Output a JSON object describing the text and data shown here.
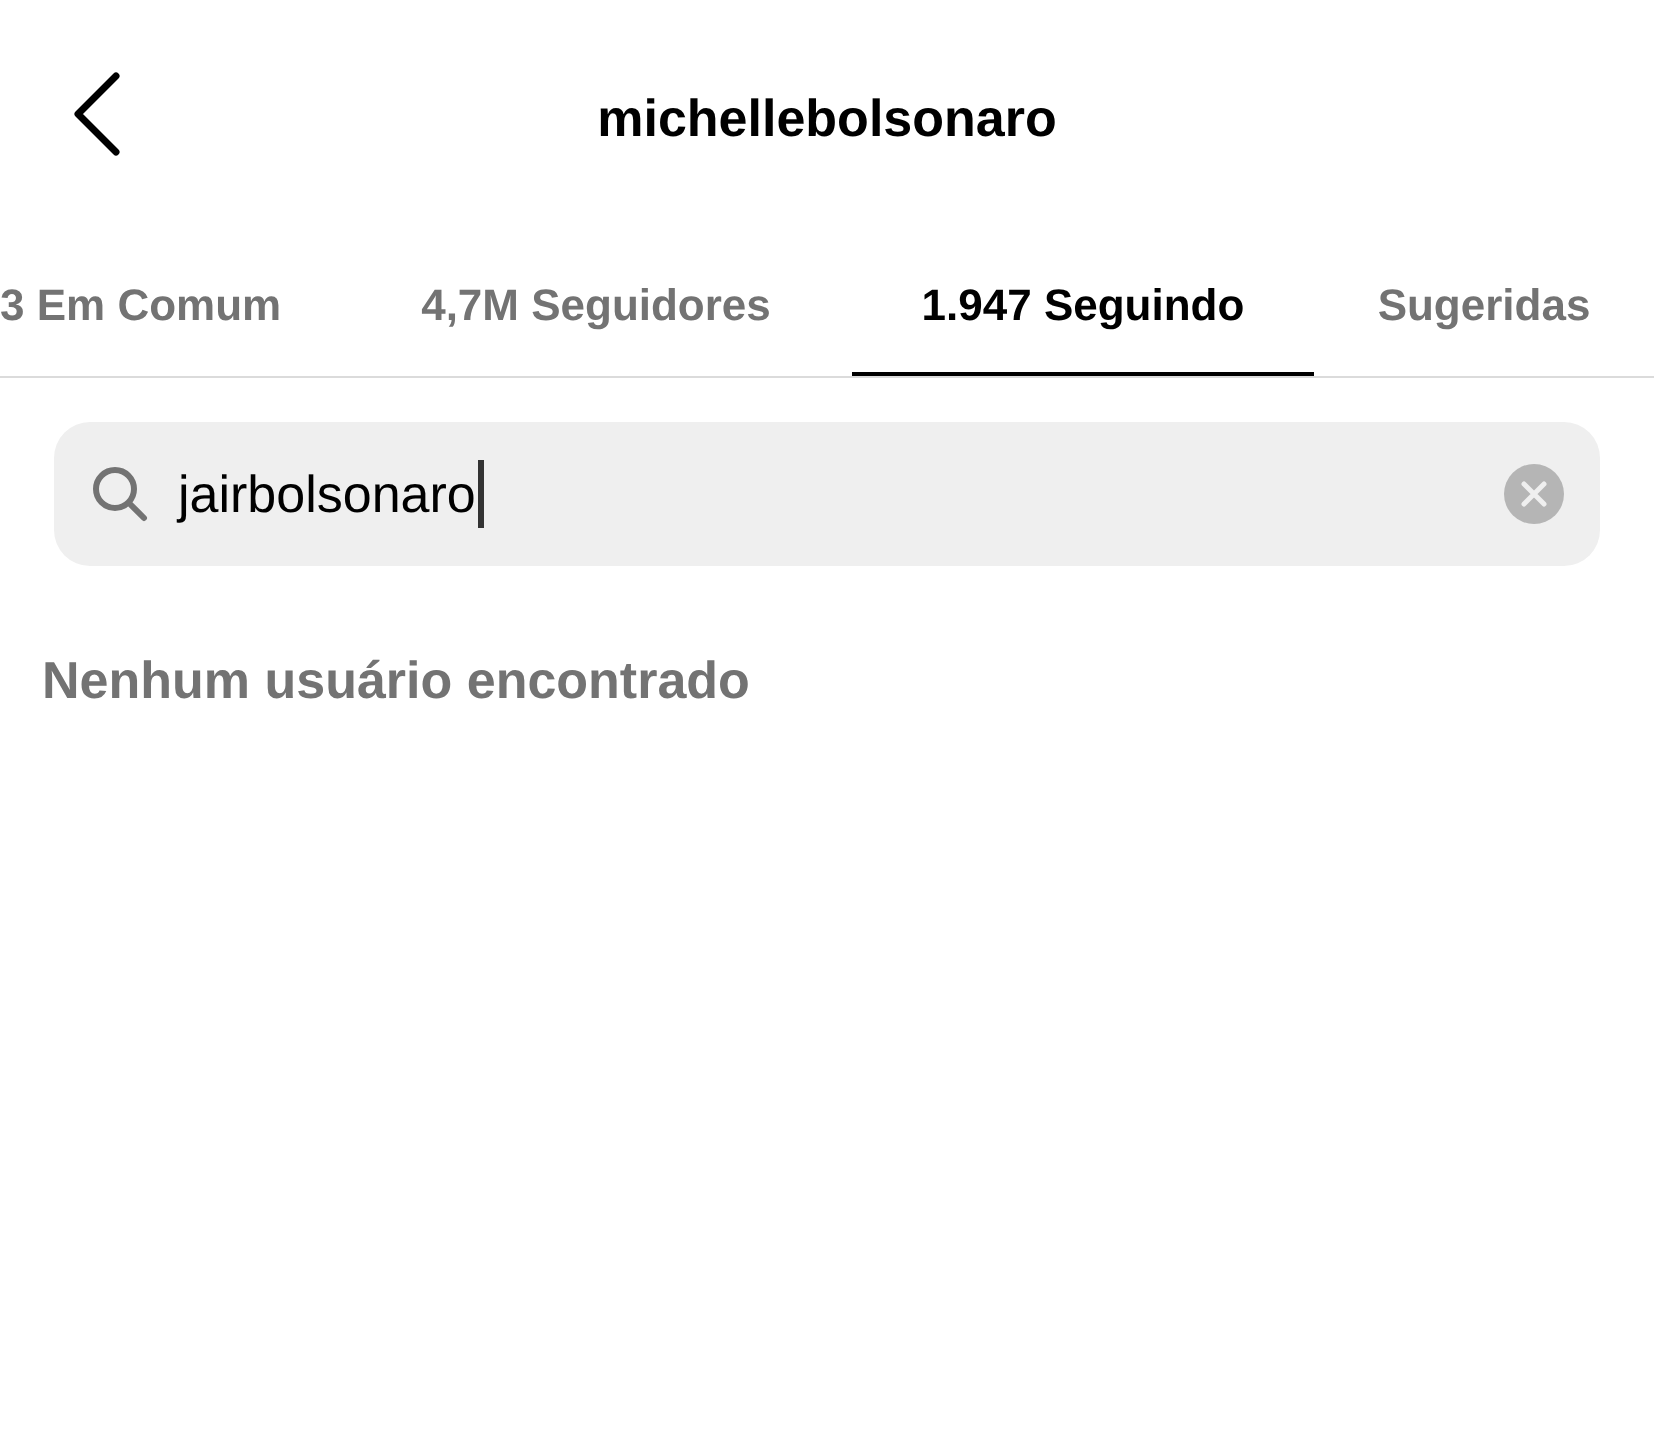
{
  "header": {
    "title": "michellebolsonaro"
  },
  "tabs": [
    {
      "label": "3 Em Comum",
      "selected": false
    },
    {
      "label": "4,7M Seguidores",
      "selected": false
    },
    {
      "label": "1.947 Seguindo",
      "selected": true
    },
    {
      "label": "Sugeridas",
      "selected": false
    }
  ],
  "search": {
    "value": "jairbolsonaro"
  },
  "empty_message": "Nenhum usuário encontrado"
}
